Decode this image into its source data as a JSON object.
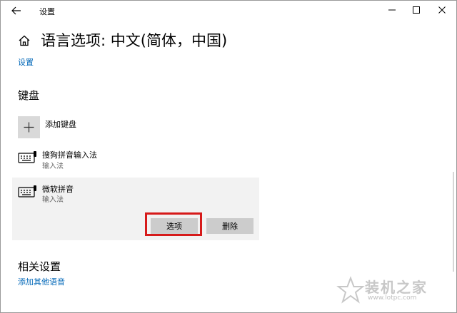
{
  "window": {
    "title": "设置"
  },
  "page": {
    "title": "语言选项: 中文(简体，中国)",
    "breadcrumb": "设置"
  },
  "keyboard_section": {
    "heading": "键盘",
    "add_label": "添加键盘",
    "items": [
      {
        "name": "搜狗拼音输入法",
        "subtitle": "输入法"
      },
      {
        "name": "微软拼音",
        "subtitle": "输入法"
      }
    ],
    "options_button": "选项",
    "delete_button": "删除"
  },
  "related_section": {
    "heading": "相关设置",
    "link": "添加其他语音"
  },
  "watermark": {
    "text": "装机之家",
    "url": "www.lotpc.com"
  },
  "colors": {
    "link": "#0067b8",
    "highlight": "#d61a1a",
    "button": "#cccccc",
    "selected_row": "#f2f2f2"
  },
  "icons": {
    "back": "arrow-left-icon",
    "minimize": "minimize-icon",
    "maximize": "maximize-icon",
    "close": "close-icon",
    "home": "home-icon",
    "add": "plus-icon",
    "keyboard": "keyboard-icon"
  }
}
